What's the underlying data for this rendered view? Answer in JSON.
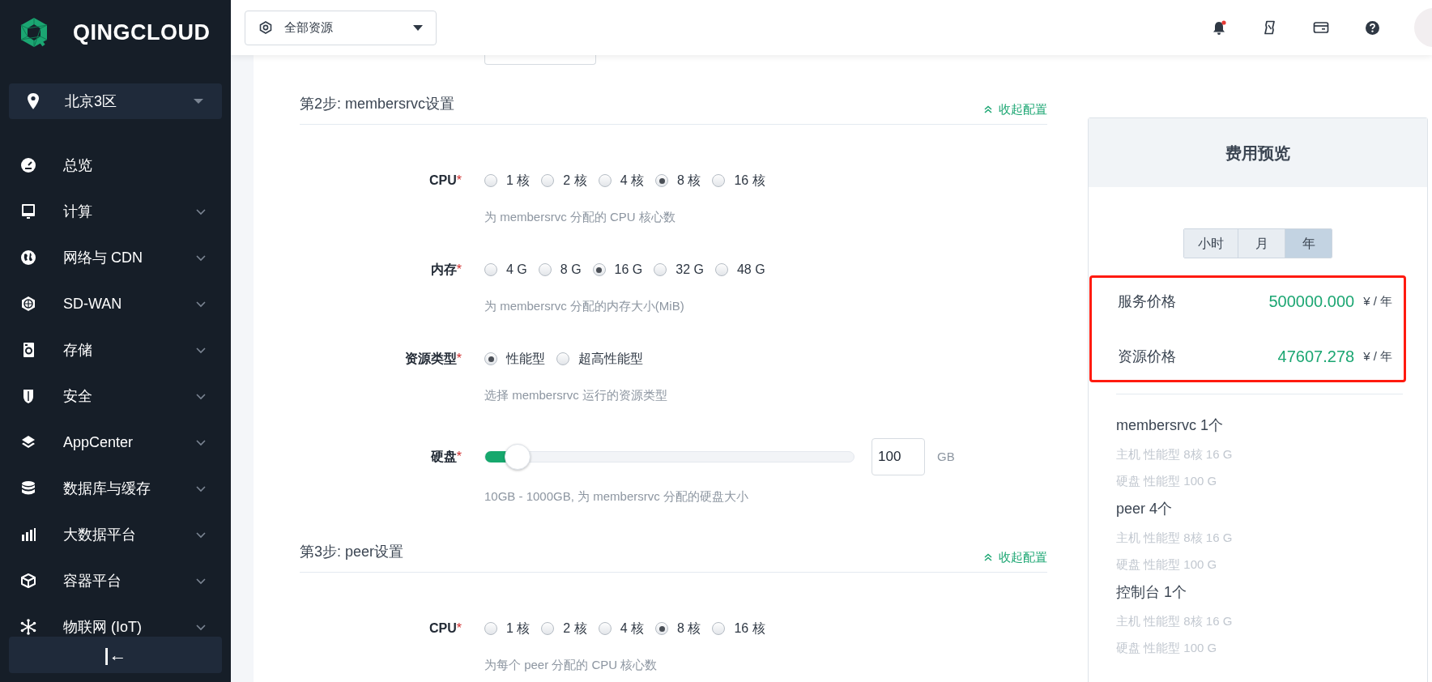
{
  "sidebar": {
    "brand": "QINGCLOUD",
    "region": "北京3区",
    "items": [
      {
        "label": "总览",
        "kind": "gauge",
        "expandable": false
      },
      {
        "label": "计算",
        "kind": "monitor",
        "expandable": true
      },
      {
        "label": "网络与 CDN",
        "kind": "globe",
        "expandable": true
      },
      {
        "label": "SD-WAN",
        "kind": "hexagon",
        "expandable": true
      },
      {
        "label": "存储",
        "kind": "disk",
        "expandable": true
      },
      {
        "label": "安全",
        "kind": "shield",
        "expandable": true
      },
      {
        "label": "AppCenter",
        "kind": "layers",
        "expandable": true
      },
      {
        "label": "数据库与缓存",
        "kind": "database",
        "expandable": true
      },
      {
        "label": "大数据平台",
        "kind": "bars",
        "expandable": true
      },
      {
        "label": "容器平台",
        "kind": "cube",
        "expandable": true
      },
      {
        "label": "物联网 (IoT)",
        "kind": "snowflake",
        "expandable": true
      }
    ],
    "collapse_label": "|←"
  },
  "topbar": {
    "scope": "全部资源",
    "notifications_unread": true
  },
  "sections": [
    {
      "title": "第2步: membersrvc设置",
      "collapse_label": "收起配置",
      "fields": [
        {
          "kind": "radio",
          "label": "CPU",
          "required_mark": "*",
          "options": [
            {
              "label": "1 核",
              "selected": false
            },
            {
              "label": "2 核",
              "selected": false
            },
            {
              "label": "4 核",
              "selected": false
            },
            {
              "label": "8 核",
              "selected": true
            },
            {
              "label": "16 核",
              "selected": false
            }
          ],
          "hint": "为 membersrvc 分配的 CPU 核心数"
        },
        {
          "kind": "radio",
          "label": "内存",
          "required_mark": "*",
          "options": [
            {
              "label": "4 G",
              "selected": false
            },
            {
              "label": "8 G",
              "selected": false
            },
            {
              "label": "16 G",
              "selected": true
            },
            {
              "label": "32 G",
              "selected": false
            },
            {
              "label": "48 G",
              "selected": false
            }
          ],
          "hint": "为 membersrvc 分配的内存大小(MiB)"
        },
        {
          "kind": "radio",
          "label": "资源类型",
          "required_mark": "*",
          "options": [
            {
              "label": "性能型",
              "selected": true
            },
            {
              "label": "超高性能型",
              "selected": false
            }
          ],
          "hint": "选择 membersrvc 运行的资源类型"
        },
        {
          "kind": "slider",
          "label": "硬盘",
          "required_mark": "*",
          "level": 0.09,
          "value": "100",
          "unit": "GB",
          "hint": "10GB - 1000GB, 为 membersrvc 分配的硬盘大小"
        }
      ]
    },
    {
      "title": "第3步: peer设置",
      "collapse_label": "收起配置",
      "fields": [
        {
          "kind": "radio",
          "label": "CPU",
          "required_mark": "*",
          "options": [
            {
              "label": "1 核",
              "selected": false
            },
            {
              "label": "2 核",
              "selected": false
            },
            {
              "label": "4 核",
              "selected": false
            },
            {
              "label": "8 核",
              "selected": true
            },
            {
              "label": "16 核",
              "selected": false
            }
          ],
          "hint": "为每个 peer 分配的 CPU 核心数"
        }
      ]
    }
  ],
  "cost_preview": {
    "title": "费用预览",
    "periods": [
      {
        "label": "小时",
        "selected": false
      },
      {
        "label": "月",
        "selected": false
      },
      {
        "label": "年",
        "selected": true
      }
    ],
    "highlighted": true,
    "prices": [
      {
        "label": "服务价格",
        "amount": "500000.000",
        "unit": "¥ / 年"
      },
      {
        "label": "资源价格",
        "amount": "47607.278",
        "unit": "¥ / 年"
      }
    ],
    "summary": [
      {
        "title": "membersrvc 1个",
        "lines": [
          "主机 性能型 8核 16 G",
          "硬盘 性能型 100 G"
        ]
      },
      {
        "title": "peer 4个",
        "lines": [
          "主机 性能型 8核 16 G",
          "硬盘 性能型 100 G"
        ]
      },
      {
        "title": "控制台 1个",
        "lines": [
          "主机 性能型 8核 16 G",
          "硬盘 性能型 100 G"
        ]
      }
    ]
  }
}
